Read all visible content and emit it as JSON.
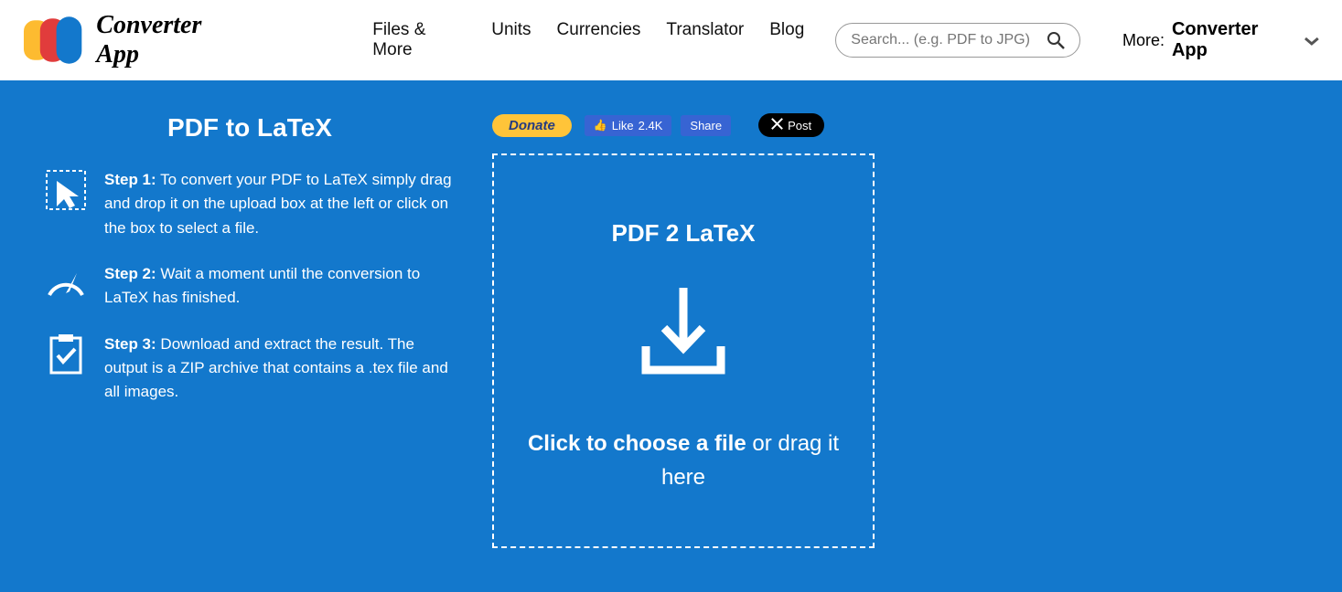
{
  "header": {
    "logo_text": "Converter App",
    "nav": [
      "Files & More",
      "Units",
      "Currencies",
      "Translator",
      "Blog"
    ],
    "search_placeholder": "Search... (e.g. PDF to JPG)",
    "more_label": "More:",
    "more_app": "Converter App"
  },
  "page": {
    "title": "PDF to LaTeX",
    "steps": [
      {
        "label": "Step 1:",
        "text": "To convert your PDF to LaTeX simply drag and drop it on the upload box at the left or click on the box to select a file."
      },
      {
        "label": "Step 2:",
        "text": "Wait a moment until the conversion to LaTeX has finished."
      },
      {
        "label": "Step 3:",
        "text": "Download and extract the result. The output is a ZIP archive that contains a .tex file and all images."
      }
    ]
  },
  "social": {
    "donate": "Donate",
    "like": "Like",
    "like_count": "2.4K",
    "share": "Share",
    "post": "Post"
  },
  "dropzone": {
    "title": "PDF 2 LaTeX",
    "cta_bold": "Click to choose a file",
    "cta_rest": " or drag it here"
  }
}
